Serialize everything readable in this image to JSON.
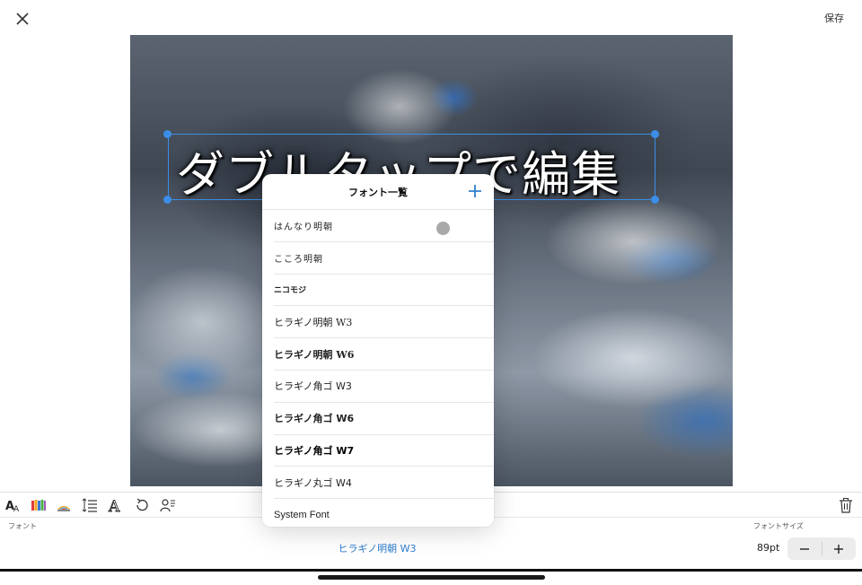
{
  "header": {
    "save_label": "保存"
  },
  "canvas": {
    "text": "ダブルタップで編集",
    "selection_color": "#3b8ee6"
  },
  "toolbar": {
    "icons": [
      "font-style-icon",
      "text-color-icon",
      "shadow-color-icon",
      "line-spacing-icon",
      "outline-text-icon",
      "rotate-icon",
      "profile-text-icon",
      "trash-icon"
    ]
  },
  "font_section": {
    "label": "フォント",
    "current_font": "ヒラギノ明朝 W3"
  },
  "size_section": {
    "label": "フォントサイズ",
    "value": "89pt",
    "minus": "−",
    "plus": "+"
  },
  "font_list": {
    "title": "フォント一覧",
    "items": [
      "はんなり明朝",
      "こころ明朝",
      "ニコモジ",
      "ヒラギノ明朝 W3",
      "ヒラギノ明朝 W6",
      "ヒラギノ角ゴ W3",
      "ヒラギノ角ゴ W6",
      "ヒラギノ角ゴ W7",
      "ヒラギノ丸ゴ W4",
      "System Font"
    ]
  },
  "colors": {
    "accent": "#2f7ecc"
  }
}
